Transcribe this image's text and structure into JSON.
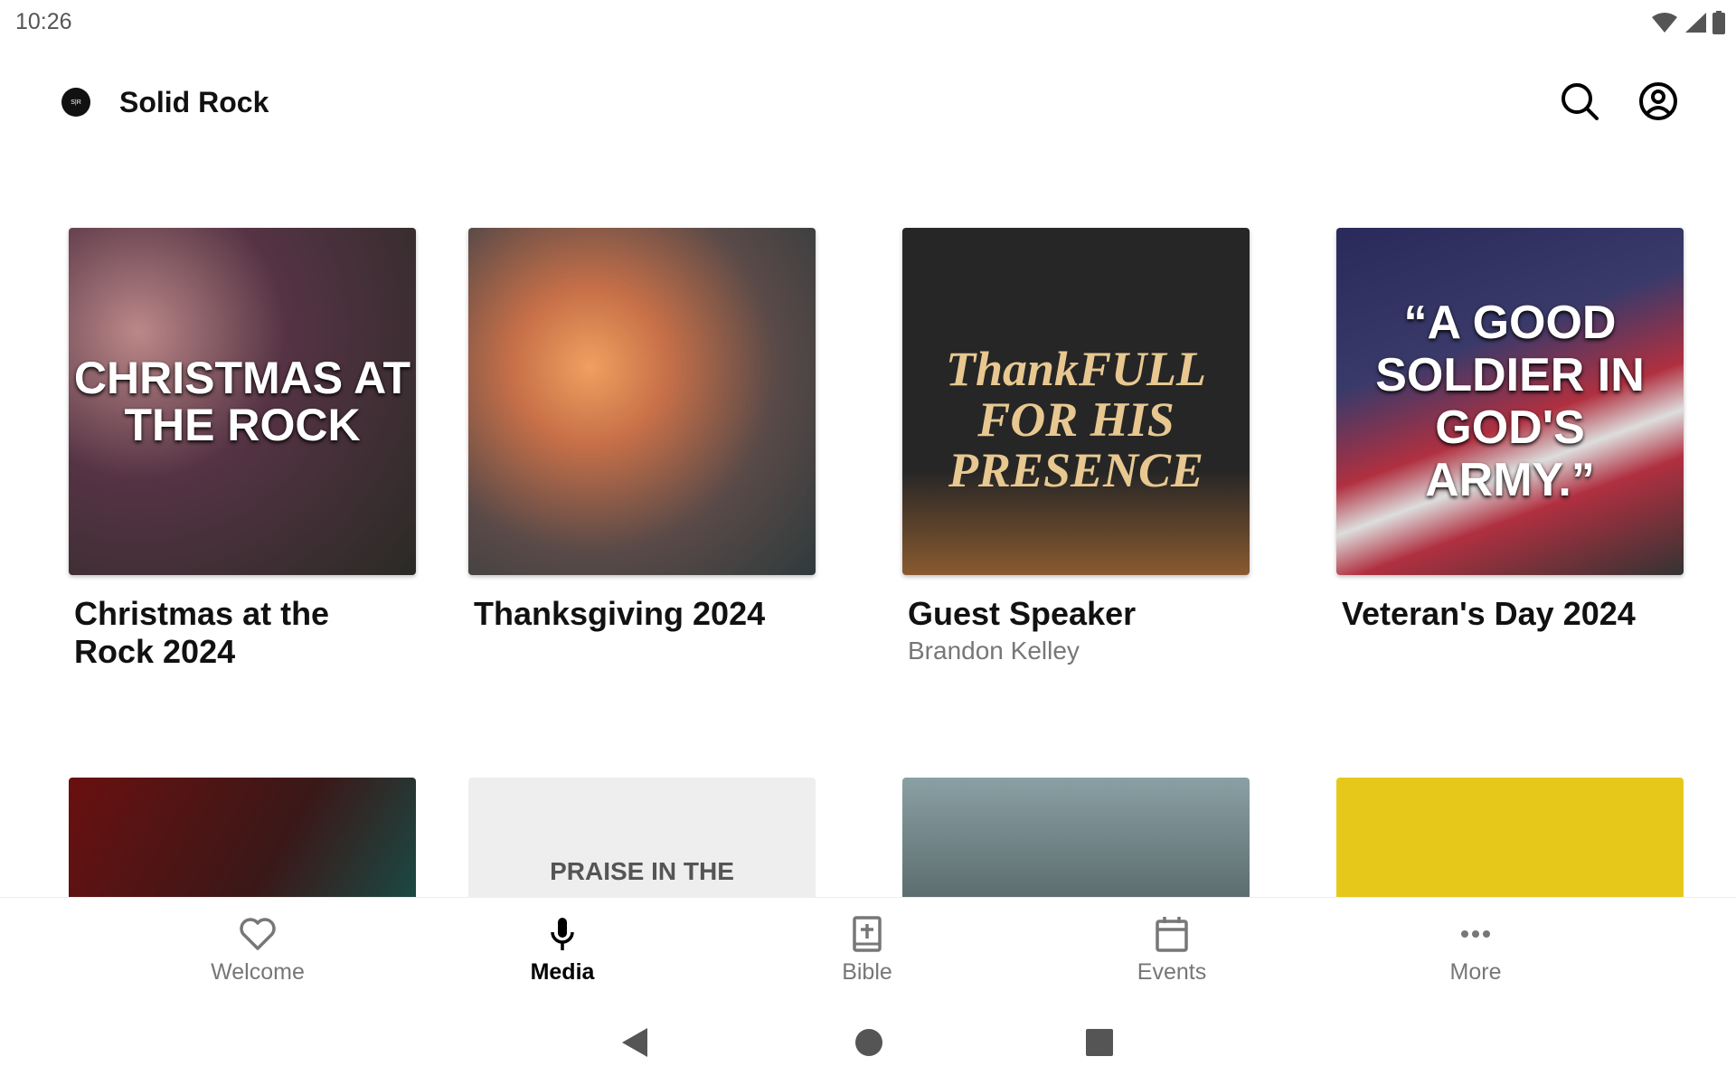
{
  "status_bar": {
    "time": "10:26",
    "icons": [
      "wifi-icon",
      "signal-icon",
      "battery-icon"
    ]
  },
  "header": {
    "title": "Solid Rock",
    "logo_text": "S|R",
    "icons": [
      "search-icon",
      "account-icon"
    ]
  },
  "media": [
    {
      "title": "Christmas at the Rock 2024",
      "poster_text": "CHRISTMAS AT THE ROCK"
    },
    {
      "title": "Thanksgiving 2024"
    },
    {
      "title": "Guest Speaker",
      "subtitle": "Brandon Kelley",
      "poster_text": "ThankFULL FOR HIS PRESENCE"
    },
    {
      "title": "Veteran's Day 2024",
      "poster_text": "“A GOOD SOLDIER IN GOD'S ARMY.”"
    }
  ],
  "media_row2": [
    {
      "poster_text": ""
    },
    {
      "poster_text": "PRAISE IN THE"
    },
    {
      "poster_text": ""
    },
    {
      "poster_text": ""
    }
  ],
  "bottom_nav": [
    {
      "label": "Welcome",
      "icon": "heart-icon"
    },
    {
      "label": "Media",
      "icon": "microphone-icon",
      "active": true
    },
    {
      "label": "Bible",
      "icon": "bible-icon"
    },
    {
      "label": "Events",
      "icon": "calendar-icon"
    },
    {
      "label": "More",
      "icon": "more-icon"
    }
  ],
  "colors": {
    "active": "#000000",
    "inactive": "#777777"
  }
}
